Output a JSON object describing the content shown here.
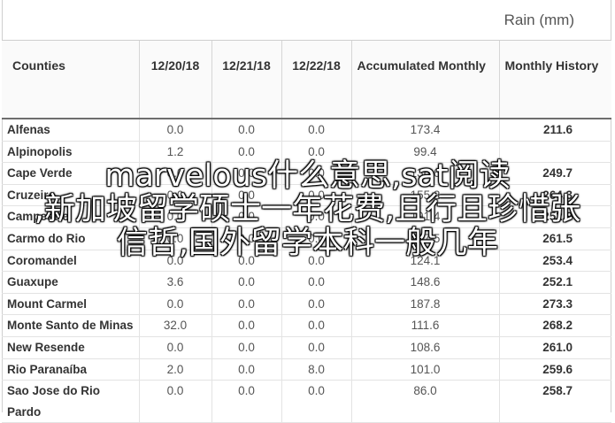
{
  "unit_label": "Rain (mm)",
  "table": {
    "headers": [
      "Counties",
      "12/20/18",
      "12/21/18",
      "12/22/18",
      "Accumulated Monthly",
      "Monthly History"
    ],
    "rows": [
      {
        "county": "Alfenas",
        "d1": "0.0",
        "d2": "0.0",
        "d3": "0.0",
        "accumulated": "173.4",
        "history": "211.6"
      },
      {
        "county": "Alpinopolis",
        "d1": "1.2",
        "d2": "0.0",
        "d3": "0.0",
        "accumulated": "99.4",
        "history": ""
      },
      {
        "county": "Cape Verde",
        "d1": "0.0",
        "d2": "0.0",
        "d3": "0.0",
        "accumulated": "136.6",
        "history": "249.7"
      },
      {
        "county": "Cruzeiro",
        "d1": "0.0",
        "d2": "0.0",
        "d3": "0.0",
        "accumulated": "155.2",
        "history": "264.3"
      },
      {
        "county": "Campestre",
        "d1": "0.0",
        "d2": "0.0",
        "d3": "0.0",
        "accumulated": "191.4",
        "history": "252.9"
      },
      {
        "county": "Carmo do Rio",
        "d1": "0.0",
        "d2": "0.0",
        "d3": "0.0",
        "accumulated": "107.5",
        "history": "261.5"
      },
      {
        "county": "Coromandel",
        "d1": "0.0",
        "d2": "0.0",
        "d3": "0.0",
        "accumulated": "124.1",
        "history": "253.4"
      },
      {
        "county": "Guaxupe",
        "d1": "3.6",
        "d2": "0.0",
        "d3": "0.0",
        "accumulated": "148.6",
        "history": "252.1"
      },
      {
        "county": "Mount Carmel",
        "d1": "0.0",
        "d2": "0.0",
        "d3": "0.0",
        "accumulated": "187.8",
        "history": "273.3"
      },
      {
        "county": "Monte Santo de Minas",
        "d1": "32.0",
        "d2": "0.0",
        "d3": "0.0",
        "accumulated": "111.6",
        "history": "268.2"
      },
      {
        "county": "New Resende",
        "d1": "0.0",
        "d2": "0.0",
        "d3": "0.0",
        "accumulated": "108.6",
        "history": "261.0"
      },
      {
        "county": "Rio Paranaíba",
        "d1": "2.0",
        "d2": "0.0",
        "d3": "8.0",
        "accumulated": "101.0",
        "history": "259.6"
      },
      {
        "county": "Sao Jose do Rio Pardo",
        "d1": "0.0",
        "d2": "0.0",
        "d3": "0.0",
        "accumulated": "86.0",
        "history": "258.7"
      }
    ]
  },
  "watermark": {
    "line1": "marvelous什么意思,sat阅读",
    "line2": ",新加坡留学硕士一年花费,且行且珍惜张",
    "line3": "信哲,国外留学本科一般几年"
  }
}
